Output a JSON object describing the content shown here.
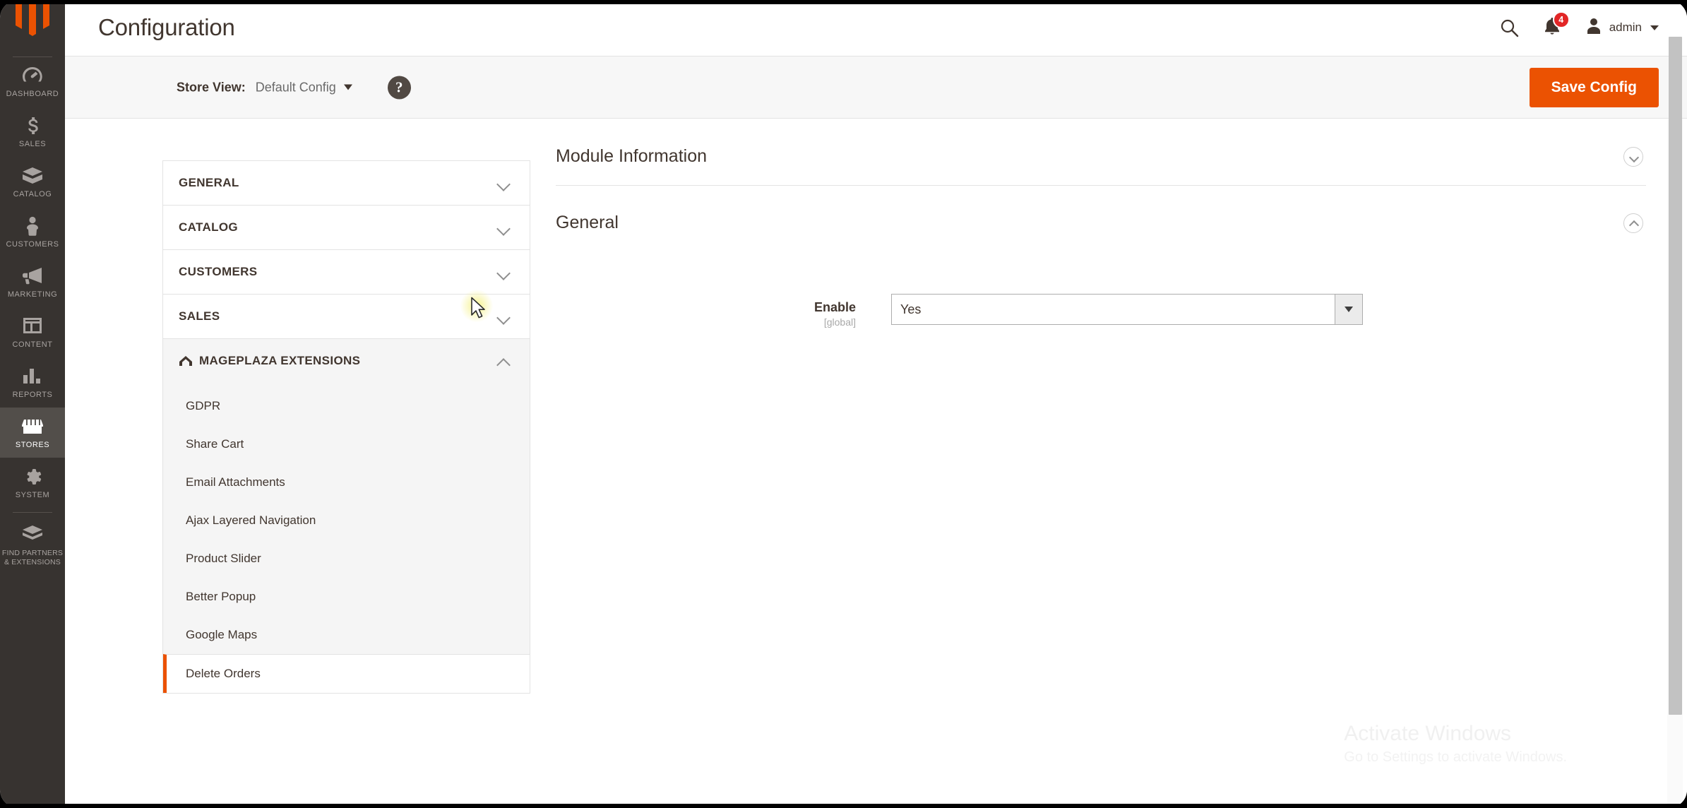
{
  "header": {
    "title": "Configuration",
    "search_icon": "search-icon",
    "notifications_icon": "bell-icon",
    "notifications_count": "4",
    "user_name": "admin",
    "user_icon": "user-avatar-icon",
    "caret_icon": "chevron-down-icon"
  },
  "page_actions": {
    "store_view_label": "Store View:",
    "store_view_value": "Default Config",
    "help_icon": "question-mark-icon",
    "help_glyph": "?",
    "save_label": "Save Config",
    "save_color": "#eb5202"
  },
  "admin_nav": {
    "logo_icon": "magento-logo-icon",
    "items": [
      {
        "label": "Dashboard",
        "icon": "dashboard-gauge-icon",
        "active": false
      },
      {
        "label": "Sales",
        "icon": "dollar-sign-icon",
        "active": false
      },
      {
        "label": "Catalog",
        "icon": "box-icon",
        "active": false
      },
      {
        "label": "Customers",
        "icon": "person-icon",
        "active": false
      },
      {
        "label": "Marketing",
        "icon": "megaphone-icon",
        "active": false
      },
      {
        "label": "Content",
        "icon": "layout-window-icon",
        "active": false
      },
      {
        "label": "Reports",
        "icon": "bar-chart-icon",
        "active": false
      },
      {
        "label": "Stores",
        "icon": "storefront-icon",
        "active": true
      },
      {
        "label": "System",
        "icon": "gear-icon",
        "active": false
      },
      {
        "label": "Find Partners\n& Extensions",
        "icon": "extension-block-icon",
        "active": false
      }
    ]
  },
  "config_nav": {
    "sections": [
      {
        "title": "General",
        "open": false,
        "logo": false
      },
      {
        "title": "Catalog",
        "open": false,
        "logo": false
      },
      {
        "title": "Customers",
        "open": false,
        "logo": false
      },
      {
        "title": "Sales",
        "open": false,
        "logo": false
      },
      {
        "title": "Mageplaza Extensions",
        "open": true,
        "logo": true
      }
    ],
    "mageplaza_items": [
      {
        "label": "GDPR",
        "active": false
      },
      {
        "label": "Share Cart",
        "active": false
      },
      {
        "label": "Email Attachments",
        "active": false
      },
      {
        "label": "Ajax Layered Navigation",
        "active": false
      },
      {
        "label": "Product Slider",
        "active": false
      },
      {
        "label": "Better Popup",
        "active": false
      },
      {
        "label": "Google Maps",
        "active": false
      },
      {
        "label": "Delete Orders",
        "active": true
      }
    ],
    "active_border_color": "#eb5202"
  },
  "content": {
    "section_module_information": "Module Information",
    "section_general": "General",
    "enable_label": "Enable",
    "enable_scope": "[global]",
    "enable_value": "Yes"
  },
  "watermark": {
    "title": "Activate Windows",
    "subtitle": "Go to Settings to activate Windows."
  }
}
